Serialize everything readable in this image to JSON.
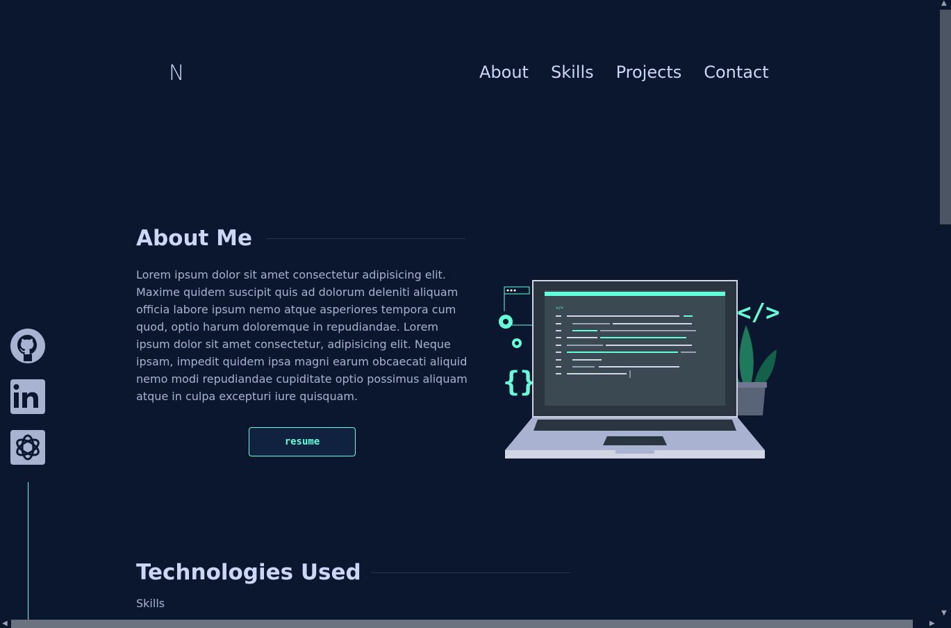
{
  "header": {
    "logo": "N",
    "nav": [
      "About",
      "Skills",
      "Projects",
      "Contact"
    ]
  },
  "social": {
    "icons": [
      "github-icon",
      "linkedin-icon",
      "openai-icon"
    ],
    "accent": "#64ffda"
  },
  "about": {
    "heading": "About Me",
    "paragraph": "Lorem ipsum dolor sit amet consectetur adipisicing elit. Maxime quidem suscipit quis ad dolorum deleniti aliquam officia labore ipsum nemo atque asperiores tempora cum quod, optio harum doloremque in repudiandae. Lorem ipsum dolor sit amet consectetur, adipisicing elit. Neque ipsam, impedit quidem ipsa magni earum obcaecati aliquid nemo modi repudiandae cupiditate optio possimus aliquam atque in culpa excepturi iure quisquam.",
    "button": "resume",
    "illustration_icon": "laptop-coding-illustration"
  },
  "technologies": {
    "heading": "Technologies Used",
    "subheading": "Skills"
  },
  "colors": {
    "background": "#0b172e",
    "text": "#ccd6f6",
    "accent": "#64ffda"
  }
}
